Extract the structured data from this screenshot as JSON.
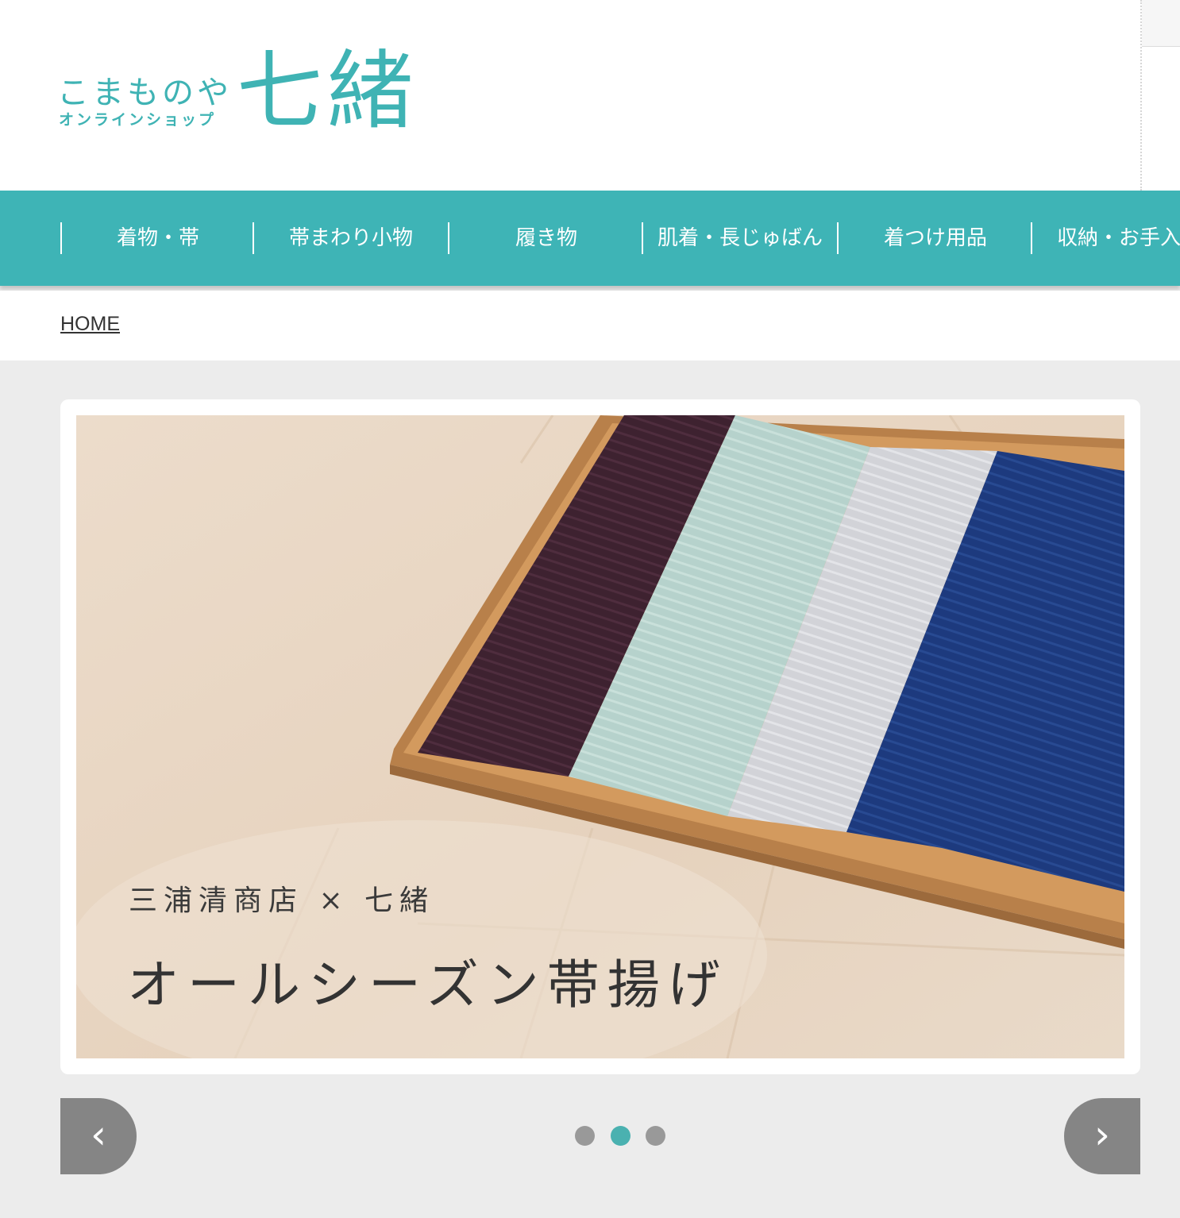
{
  "logo": {
    "line1": "こまものや",
    "line2": "オンラインショップ",
    "main": "七緒"
  },
  "nav": {
    "items": [
      {
        "label": "着物・帯"
      },
      {
        "label": "帯まわり小物"
      },
      {
        "label": "履き物"
      },
      {
        "label": "肌着・長じゅばん"
      },
      {
        "label": "着つけ用品"
      },
      {
        "label": "収納・お手入れ"
      }
    ]
  },
  "breadcrumb": {
    "home": "HOME"
  },
  "slider": {
    "caption_sub": "三浦清商店 × 七緒",
    "caption_main": "オールシーズン帯揚げ",
    "prev_icon": "chevron-left-icon",
    "next_icon": "chevron-right-icon",
    "prev_glyph": "‹",
    "next_glyph": "›",
    "dots": 3,
    "active_dot": 2
  },
  "colors": {
    "brand": "#3fb3b4",
    "nav_bg": "#3eb4b6",
    "page_bg": "#ececec",
    "dot_active": "#4ab1b0",
    "dot_inactive": "#999999",
    "arrow_bg": "#858585"
  }
}
